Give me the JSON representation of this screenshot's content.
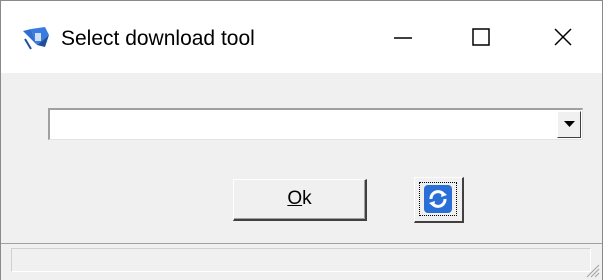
{
  "window": {
    "title": "Select download tool",
    "app_icon": "download-tool-app-icon",
    "caption_buttons": {
      "minimize_icon": "minimize-icon",
      "maximize_icon": "maximize-icon",
      "close_icon": "close-icon"
    }
  },
  "combo": {
    "selected_value": "",
    "arrow_icon": "dropdown-arrow-icon"
  },
  "ok_button": {
    "mnemonic": "O",
    "rest": "k"
  },
  "refresh_button": {
    "icon": "refresh-icon"
  },
  "colors": {
    "face": "#f0f0f0",
    "title_bg": "#ffffff",
    "refresh_blue": "#2a6fd6"
  }
}
